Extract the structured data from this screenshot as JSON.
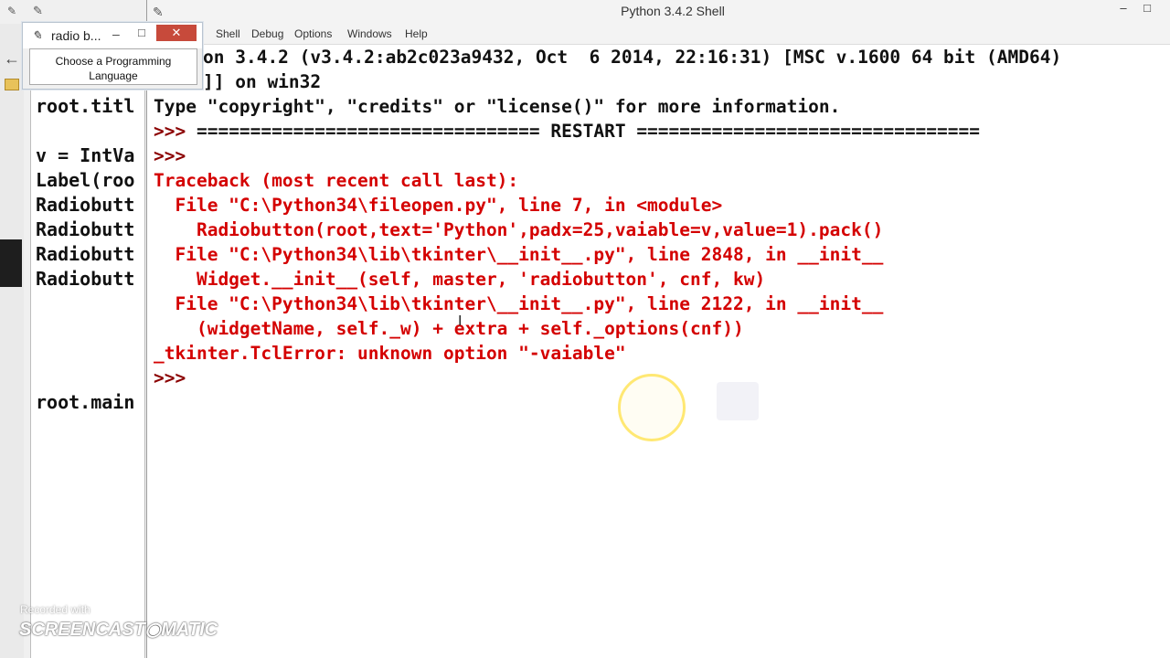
{
  "background_editor": {
    "lines": [
      {
        "text": "root.titl",
        "top": 0
      },
      {
        "text": "v = IntVa",
        "top": 0
      },
      {
        "text": "Label(roo",
        "top": 0
      },
      {
        "text": "Radiobutt",
        "top": 0
      },
      {
        "text": "Radiobutt",
        "top": 0
      },
      {
        "text": "Radiobutt",
        "top": 0
      },
      {
        "text": "Radiobutt",
        "top": 0
      },
      {
        "text": "root.main",
        "top": 0
      }
    ]
  },
  "shell": {
    "title": "Python 3.4.2 Shell",
    "menu": [
      "Shell",
      "Debug",
      "Options",
      "Windows",
      "Help"
    ],
    "lines": [
      {
        "text": "on 3.4.2 (v3.4.2:ab2c023a9432, Oct  6 2014, 22:16:31) [MSC v.1600 64 bit (AMD64)",
        "color": "black"
      },
      {
        "text": "]] on win32",
        "color": "black"
      },
      {
        "text": "Type \"copyright\", \"credits\" or \"license()\" for more information.",
        "color": "black"
      },
      {
        "text": ">>> ================================ RESTART ================================",
        "color": "mixed-restart"
      },
      {
        "text": ">>>",
        "color": "prompt"
      },
      {
        "text": "Traceback (most recent call last):",
        "color": "red"
      },
      {
        "text": "  File \"C:\\Python34\\fileopen.py\", line 7, in <module>",
        "color": "red"
      },
      {
        "text": "    Radiobutton(root,text='Python',padx=25,vaiable=v,value=1).pack()",
        "color": "red"
      },
      {
        "text": "  File \"C:\\Python34\\lib\\tkinter\\__init__.py\", line 2848, in __init__",
        "color": "red"
      },
      {
        "text": "    Widget.__init__(self, master, 'radiobutton', cnf, kw)",
        "color": "red"
      },
      {
        "text": "  File \"C:\\Python34\\lib\\tkinter\\__init__.py\", line 2122, in __init__",
        "color": "red"
      },
      {
        "text": "    (widgetName, self._w) + extra + self._options(cnf))",
        "color": "red"
      },
      {
        "text": "_tkinter.TclError: unknown option \"-vaiable\"",
        "color": "red"
      },
      {
        "text": ">>>",
        "color": "prompt"
      }
    ]
  },
  "popup": {
    "title": "radio b...",
    "label": "Choose a Programming Language"
  },
  "watermark": {
    "recorded": "Recorded with",
    "brand": "SCREENCAST◉MATIC"
  },
  "colors": {
    "error_red": "#d40000",
    "prompt": "#8b0000",
    "close_button": "#c74a3b"
  }
}
